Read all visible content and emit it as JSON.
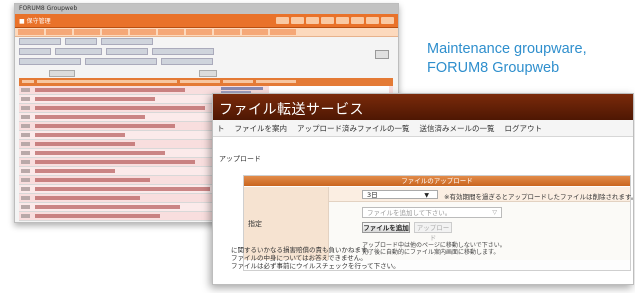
{
  "caption": {
    "line1": "Maintenance groupware,",
    "line2": "FORUM8 Groupweb"
  },
  "groupweb": {
    "window_title": "FORUM8 Groupweb",
    "header_name": "■ 保守管理"
  },
  "file_transfer": {
    "title": "ファイル転送サービス",
    "nav": [
      "ト",
      "ファイルを案内",
      "アップロード済みファイルの一覧",
      "送信済みメールの一覧",
      "ログアウト"
    ],
    "page_title": "アップロード",
    "panel_title": "ファイルのアップロード",
    "retention_value": "3日",
    "retention_note": "※有効期間を過ぎるとアップロードしたファイルは削除されます。",
    "file_input_placeholder": "ファイルを追加して下さい。",
    "add_file_button": "ファイルを追加",
    "upload_button": "アップロード",
    "row_label": "指定",
    "upload_note_1": "アップロード中は他のページに移動しないで下さい。",
    "upload_note_2": "完了後に自動的にファイル案内画面に移動します。",
    "footer_1": "に関するいかなる損害賠償の責も負いかねます。",
    "footer_2": "ファイルの中身についてはお答えできません。",
    "footer_3": "ファイルは必ず事前にウイルスチェックを行って下さい。"
  },
  "colors": {
    "caption": "#2f8fcd",
    "groupweb_accent": "#e9722a",
    "transfer_header": "#5a1c05",
    "panel_header": "#d4742f"
  }
}
